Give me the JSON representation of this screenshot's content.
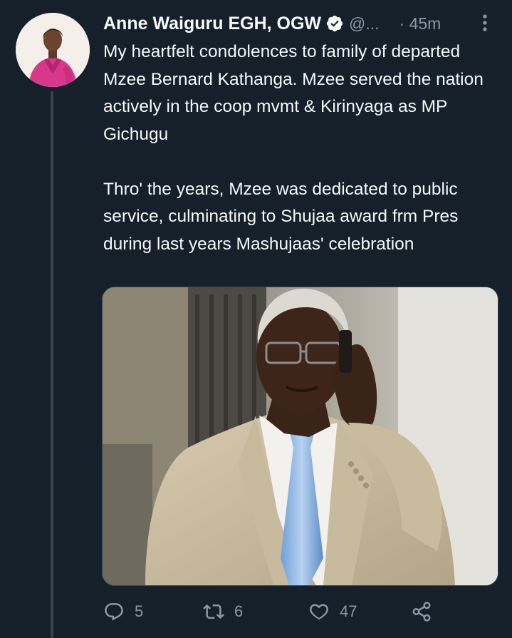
{
  "author": {
    "name": "Anne Waiguru EGH, OGW",
    "handle": "@...",
    "verified": true,
    "avatar_icon": "profile-photo"
  },
  "tweet": {
    "time": "· 45m",
    "text": "My heartfelt condolences to family of departed Mzee Bernard  Kathanga. Mzee served the nation actively in the coop mvmt & Kirinyaga as MP Gichugu\n\nThro' the years, Mzee was dedicated to public service, culminating to Shujaa award frm Pres during last years Mashujaas' celebration",
    "media_icon": "photo-man-on-phone"
  },
  "actions": {
    "reply": {
      "icon": "reply-icon",
      "count": "5"
    },
    "retweet": {
      "icon": "retweet-icon",
      "count": "6"
    },
    "like": {
      "icon": "heart-icon",
      "count": "47"
    },
    "share": {
      "icon": "share-icon"
    }
  },
  "colors": {
    "background": "#15202b",
    "text": "#f7f9f9",
    "secondary": "#8b98a5",
    "thread_line": "#38444d",
    "verified_badge": "#f7f9f9"
  }
}
